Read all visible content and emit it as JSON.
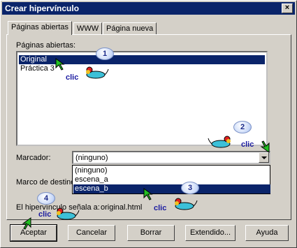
{
  "window": {
    "title": "Crear hipervínculo",
    "close": "×"
  },
  "tabs": [
    {
      "label": "Páginas abiertas"
    },
    {
      "label": "WWW"
    },
    {
      "label": "Página nueva"
    }
  ],
  "open_pages": {
    "label": "Páginas abiertas:",
    "items": [
      "Original",
      "Práctica 3"
    ],
    "selected": "Original"
  },
  "bookmark": {
    "label": "Marcador:",
    "value": "(ninguno)",
    "options": [
      "(ninguno)",
      "escena_a",
      "escena_b"
    ],
    "highlighted": "escena_b"
  },
  "target_frame": {
    "label": "Marco de destino:"
  },
  "link_target": {
    "label": "El hipervínculo señala a:",
    "value": "original.html"
  },
  "buttons": {
    "accept": "Aceptar",
    "cancel": "Cancelar",
    "delete": "Borrar",
    "extended": "Extendido...",
    "help": "Ayuda"
  },
  "annotations": {
    "steps": [
      "1",
      "2",
      "3",
      "4"
    ],
    "click_text": "clic",
    "colors": {
      "mouse_body": "#3cc0d8",
      "mouse_ear": "#e02020",
      "arrow": "#22c022",
      "badge": "#c8d8f8"
    }
  }
}
